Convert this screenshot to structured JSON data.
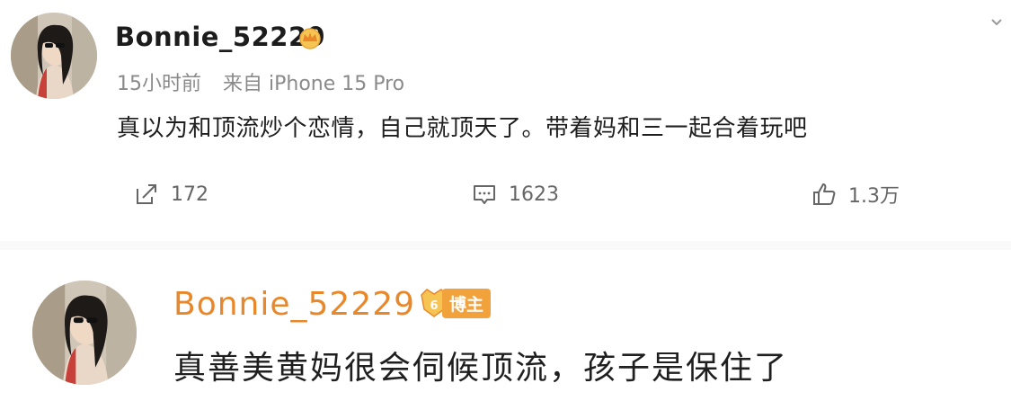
{
  "post": {
    "username": "Bonnie_52229",
    "time": "15小时前",
    "source": "来自 iPhone 15 Pro",
    "content": "真以为和顶流炒个恋情，自己就顶天了。带着妈和三一起合着玩吧",
    "actions": {
      "repost_count": "172",
      "comment_count": "1623",
      "like_count": "1.3万"
    }
  },
  "reply": {
    "username": "Bonnie_52229",
    "badge_level": "6",
    "badge_label": "博主",
    "content": "真善美黄妈很会伺候顶流，孩子是保住了"
  },
  "colors": {
    "username_highlight": "#e8882a",
    "badge": "#f2a23a",
    "muted_text": "#8a8a8a"
  }
}
